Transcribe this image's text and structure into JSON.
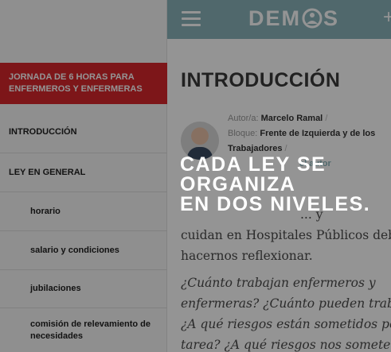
{
  "header": {
    "menu_icon": "hamburger-icon",
    "logo": {
      "text_left": "DEM",
      "text_right": "S"
    },
    "plus_label": "+"
  },
  "sidebar": {
    "law_title": "JORNADA DE 6 HORAS PARA ENFERMEROS Y ENFERMERAS",
    "items": [
      {
        "label": "INTRODUCCIÓN"
      },
      {
        "label": "LEY EN GENERAL"
      },
      {
        "label": "horario"
      },
      {
        "label": "salario y condiciones"
      },
      {
        "label": "jubilaciones"
      },
      {
        "label": "comisión de relevamiento de necesidades"
      }
    ]
  },
  "content": {
    "title": "INTRODUCCIÓN",
    "meta": {
      "author_label": "Autor/a:",
      "author": "Marcelo Ramal",
      "bloque_label": "Bloque:",
      "bloque": "Frente de Izquierda y de los Trabajadores",
      "sep": "/",
      "more_link": "el autor"
    },
    "body": {
      "line1": "... y",
      "line2": "cuidan en Hospitales Públicos deb",
      "line3": "hacernos reflexionar.",
      "q1": "¿Cuánto trabajan enfermeros y",
      "q2": "enfermeras? ¿Cuánto pueden trabajar",
      "q3": "¿A qué riesgos están sometidos por su",
      "q4": "tarea? ¿A qué riesgos nos someten?"
    }
  },
  "overlay": {
    "line1": "CADA LEY SE",
    "line2": "ORGANIZA",
    "line3": "EN DOS NIVELES."
  },
  "colors": {
    "header": "#8ab4ba",
    "law_title_bg": "#d8262c",
    "overlay": "rgba(0,0,0,0.42)"
  }
}
